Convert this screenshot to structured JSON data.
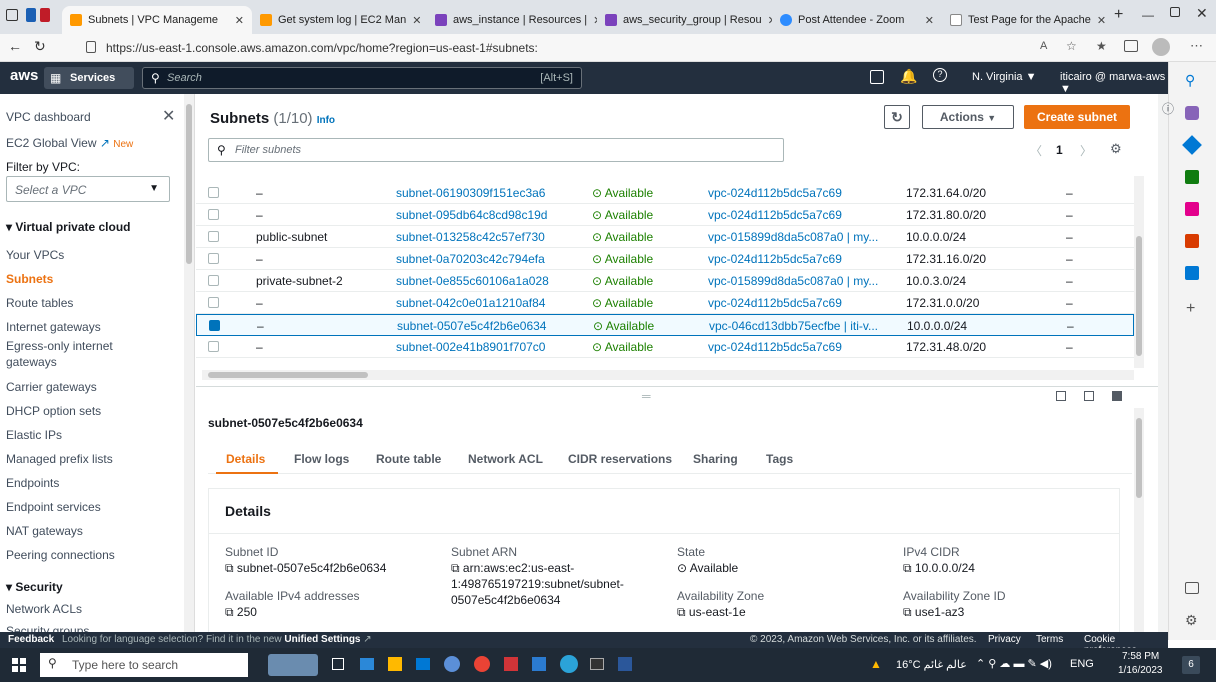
{
  "browser": {
    "tabs": [
      {
        "label": "Subnets | VPC Manageme",
        "color": "#ff9900"
      },
      {
        "label": "Get system log | EC2 Man",
        "color": "#ff9900"
      },
      {
        "label": "aws_instance | Resources |",
        "color": "#7b42bc"
      },
      {
        "label": "aws_security_group | Resou",
        "color": "#7b42bc"
      },
      {
        "label": "Post Attendee - Zoom",
        "color": "#2d8cff"
      },
      {
        "label": "Test Page for the Apache",
        "color": "#888888"
      }
    ],
    "url": "https://us-east-1.console.aws.amazon.com/vpc/home?region=us-east-1#subnets:"
  },
  "awsnav": {
    "logo": "aws",
    "services": "Services",
    "search_placeholder": "Search",
    "shortcut": "[Alt+S]",
    "region": "N. Virginia ▼",
    "account": "iticairo @ marwa-aws ▼"
  },
  "leftnav": {
    "dashboard": "VPC dashboard",
    "global_view": "EC2 Global View",
    "new_badge": "New",
    "filter_label": "Filter by VPC:",
    "select_placeholder": "Select a VPC",
    "section_vpc": "Virtual private cloud",
    "items": [
      "Your VPCs",
      "Subnets",
      "Route tables",
      "Internet gateways",
      "Egress-only internet gateways",
      "Carrier gateways",
      "DHCP option sets",
      "Elastic IPs",
      "Managed prefix lists",
      "Endpoints",
      "Endpoint services",
      "NAT gateways",
      "Peering connections"
    ],
    "section_security": "Security",
    "security_items": [
      "Network ACLs",
      "Security groups"
    ]
  },
  "table": {
    "title": "Subnets",
    "count": "(1/10)",
    "info": "Info",
    "actions": "Actions",
    "create": "Create subnet",
    "filter_placeholder": "Filter subnets",
    "page": "1",
    "rows": [
      {
        "name": "–",
        "id": "subnet-06190309f151ec3a6",
        "state": "Available",
        "vpc": "vpc-024d112b5dc5a7c69",
        "cidr": "172.31.64.0/20",
        "ipv6": "–",
        "checked": false
      },
      {
        "name": "–",
        "id": "subnet-095db64c8cd98c19d",
        "state": "Available",
        "vpc": "vpc-024d112b5dc5a7c69",
        "cidr": "172.31.80.0/20",
        "ipv6": "–",
        "checked": false
      },
      {
        "name": "public-subnet",
        "id": "subnet-013258c42c57ef730",
        "state": "Available",
        "vpc": "vpc-015899d8da5c087a0 | my...",
        "cidr": "10.0.0.0/24",
        "ipv6": "–",
        "checked": false
      },
      {
        "name": "–",
        "id": "subnet-0a70203c42c794efa",
        "state": "Available",
        "vpc": "vpc-024d112b5dc5a7c69",
        "cidr": "172.31.16.0/20",
        "ipv6": "–",
        "checked": false
      },
      {
        "name": "private-subnet-2",
        "id": "subnet-0e855c60106a1a028",
        "state": "Available",
        "vpc": "vpc-015899d8da5c087a0 | my...",
        "cidr": "10.0.3.0/24",
        "ipv6": "–",
        "checked": false
      },
      {
        "name": "–",
        "id": "subnet-042c0e01a1210af84",
        "state": "Available",
        "vpc": "vpc-024d112b5dc5a7c69",
        "cidr": "172.31.0.0/20",
        "ipv6": "–",
        "checked": false
      },
      {
        "name": "–",
        "id": "subnet-0507e5c4f2b6e0634",
        "state": "Available",
        "vpc": "vpc-046cd13dbb75ecfbe | iti-v...",
        "cidr": "10.0.0.0/24",
        "ipv6": "–",
        "checked": true
      },
      {
        "name": "–",
        "id": "subnet-002e41b8901f707c0",
        "state": "Available",
        "vpc": "vpc-024d112b5dc5a7c69",
        "cidr": "172.31.48.0/20",
        "ipv6": "–",
        "checked": false
      }
    ]
  },
  "detail": {
    "subnet_title": "subnet-0507e5c4f2b6e0634",
    "tabs": [
      "Details",
      "Flow logs",
      "Route table",
      "Network ACL",
      "CIDR reservations",
      "Sharing",
      "Tags"
    ],
    "heading": "Details",
    "fields": {
      "subnet_id_label": "Subnet ID",
      "subnet_id": "subnet-0507e5c4f2b6e0634",
      "arn_label": "Subnet ARN",
      "arn_line1": "arn:aws:ec2:us-east-",
      "arn_line2": "1:498765197219:subnet/subnet-",
      "arn_line3": "0507e5c4f2b6e0634",
      "state_label": "State",
      "state": "Available",
      "cidr_label": "IPv4 CIDR",
      "cidr": "10.0.0.0/24",
      "avail_ip_label": "Available IPv4 addresses",
      "avail_ip": "250",
      "az_label": "Availability Zone",
      "az": "us-east-1e",
      "azid_label": "Availability Zone ID",
      "azid": "use1-az3"
    }
  },
  "footer": {
    "feedback": "Feedback",
    "prompt": "Looking for language selection? Find it in the new",
    "unified": "Unified Settings",
    "copyright": "© 2023, Amazon Web Services, Inc. or its affiliates.",
    "privacy": "Privacy",
    "terms": "Terms",
    "cookies": "Cookie preferences"
  },
  "taskbar": {
    "search_placeholder": "Type here to search",
    "weather": "16°C عالم غائم",
    "lang": "ENG",
    "time": "7:58 PM",
    "date": "1/16/2023",
    "notif": "6"
  }
}
